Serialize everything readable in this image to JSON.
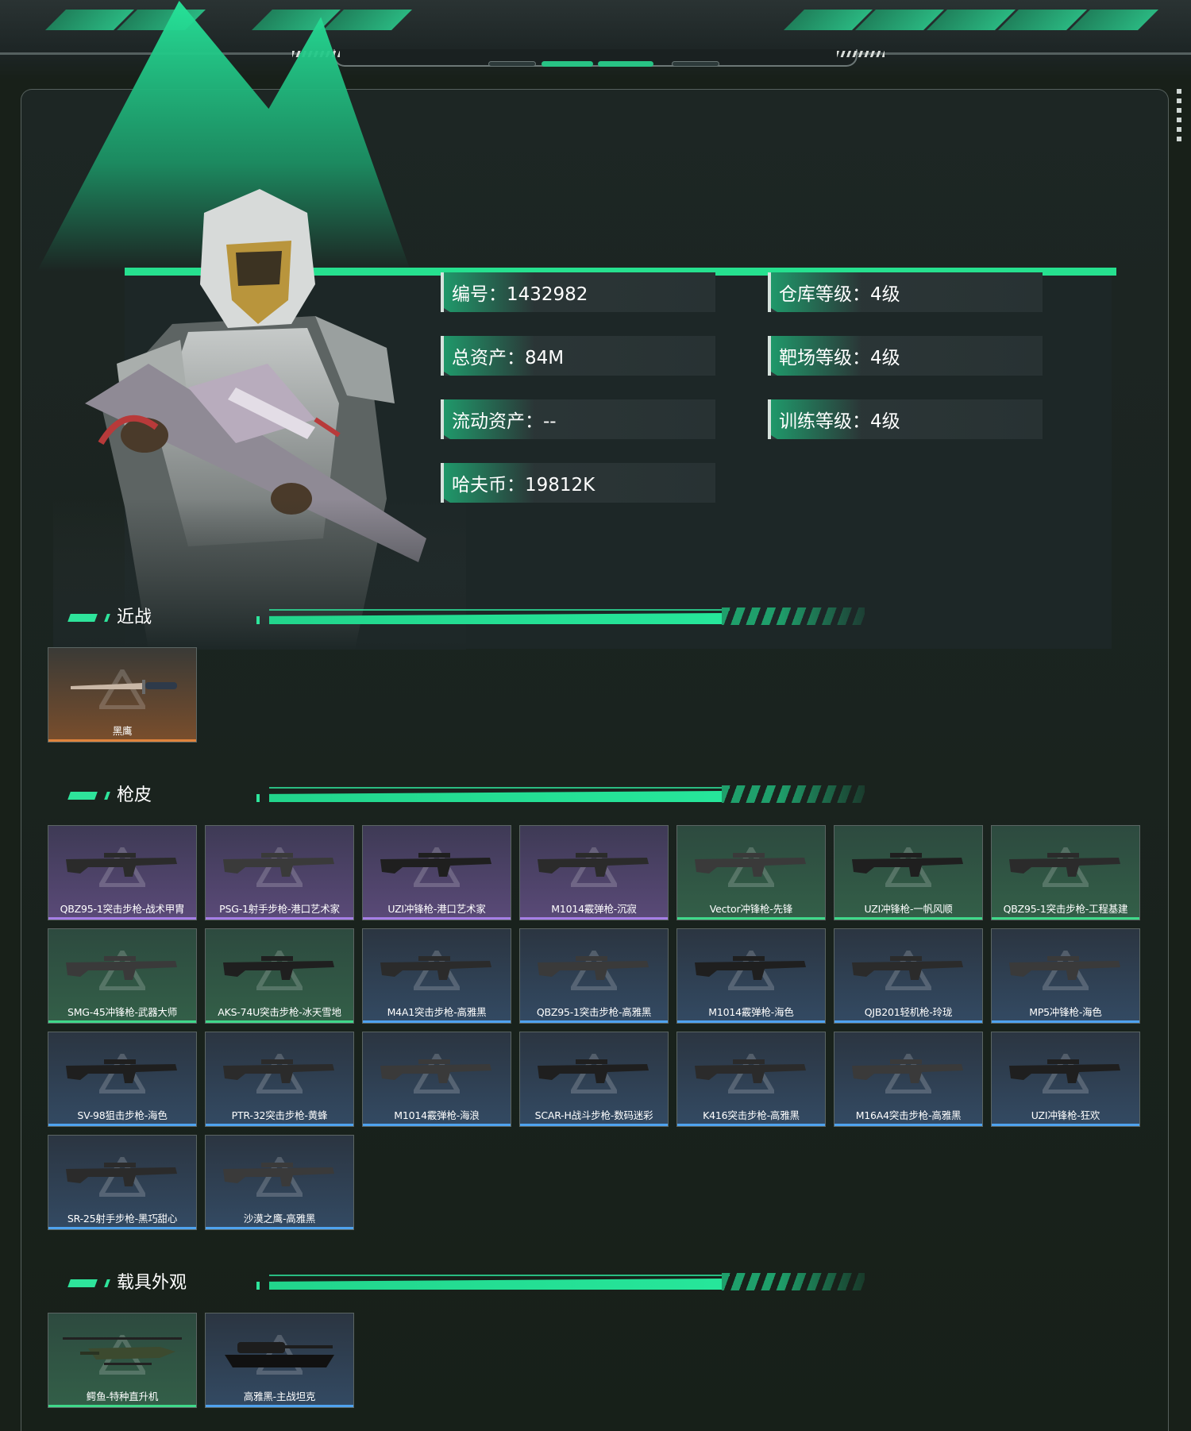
{
  "profile": {
    "stats": [
      {
        "label": "编号：1432982"
      },
      {
        "label": "仓库等级：4级"
      },
      {
        "label": "总资产：84M"
      },
      {
        "label": "靶场等级：4级"
      },
      {
        "label": "流动资产：--"
      },
      {
        "label": "训练等级：4级"
      },
      {
        "label": "哈夫币：19812K"
      }
    ]
  },
  "sections": {
    "melee": {
      "title": "近战",
      "items": [
        {
          "name": "黑鹰",
          "rarity": "orange"
        }
      ]
    },
    "skins": {
      "title": "枪皮",
      "items": [
        {
          "name": "QBZ95-1突击步枪-战术甲胄",
          "rarity": "purple"
        },
        {
          "name": "PSG-1射手步枪-港口艺术家",
          "rarity": "purple"
        },
        {
          "name": "UZI冲锋枪-港口艺术家",
          "rarity": "purple"
        },
        {
          "name": "M1014霰弹枪-沉寂",
          "rarity": "purple"
        },
        {
          "name": "Vector冲锋枪-先锋",
          "rarity": "green"
        },
        {
          "name": "UZI冲锋枪-一帆风顺",
          "rarity": "green"
        },
        {
          "name": "QBZ95-1突击步枪-工程基建",
          "rarity": "green"
        },
        {
          "name": "SMG-45冲锋枪-武器大师",
          "rarity": "green"
        },
        {
          "name": "AKS-74U突击步枪-冰天雪地",
          "rarity": "green"
        },
        {
          "name": "M4A1突击步枪-高雅黑",
          "rarity": "blue"
        },
        {
          "name": "QBZ95-1突击步枪-高雅黑",
          "rarity": "blue"
        },
        {
          "name": "M1014霰弹枪-海色",
          "rarity": "blue"
        },
        {
          "name": "QJB201轻机枪-玲珑",
          "rarity": "blue"
        },
        {
          "name": "MP5冲锋枪-海色",
          "rarity": "blue"
        },
        {
          "name": "SV-98狙击步枪-海色",
          "rarity": "blue"
        },
        {
          "name": "PTR-32突击步枪-黄蜂",
          "rarity": "blue"
        },
        {
          "name": "M1014霰弹枪-海浪",
          "rarity": "blue"
        },
        {
          "name": "SCAR-H战斗步枪-数码迷彩",
          "rarity": "blue"
        },
        {
          "name": "K416突击步枪-高雅黑",
          "rarity": "blue"
        },
        {
          "name": "M16A4突击步枪-高雅黑",
          "rarity": "blue"
        },
        {
          "name": "UZI冲锋枪-狂欢",
          "rarity": "blue"
        },
        {
          "name": "SR-25射手步枪-黑巧甜心",
          "rarity": "blue"
        },
        {
          "name": "沙漠之鹰-高雅黑",
          "rarity": "blue"
        }
      ]
    },
    "vehicles": {
      "title": "载具外观",
      "items": [
        {
          "name": "鳄鱼-特种直升机",
          "rarity": "green"
        },
        {
          "name": "高雅黑-主战坦克",
          "rarity": "blue"
        }
      ]
    }
  },
  "colors": {
    "accent": "#26e08f",
    "purple": "#a57ee6",
    "green": "#3fd98a",
    "blue": "#4fa3ef",
    "orange": "#e0843d"
  }
}
